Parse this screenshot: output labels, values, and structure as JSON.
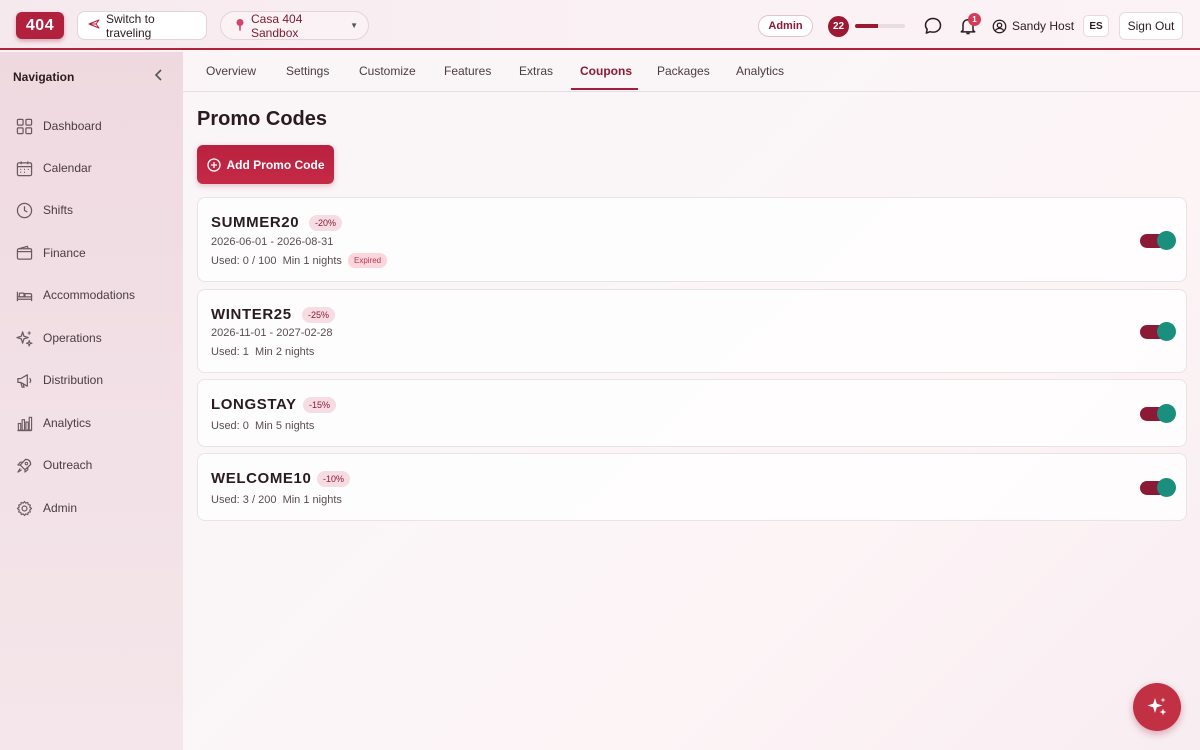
{
  "header": {
    "logo": "404",
    "switch_label": "Switch to traveling",
    "property_label": "Casa 404 Sandbox",
    "role_badge": "Admin",
    "level": "22",
    "level_progress": 0.45,
    "notification_count": "1",
    "user_name": "Sandy Host",
    "language": "ES",
    "signout_label": "Sign Out",
    "icons": [
      "plane-icon",
      "pin-icon",
      "chat-icon",
      "bell-icon",
      "user-icon"
    ]
  },
  "sidebar": {
    "title": "Navigation",
    "items": [
      {
        "label": "Dashboard",
        "icon": "dashboard-icon"
      },
      {
        "label": "Calendar",
        "icon": "calendar-icon"
      },
      {
        "label": "Shifts",
        "icon": "clock-icon"
      },
      {
        "label": "Finance",
        "icon": "wallet-icon"
      },
      {
        "label": "Accommodations",
        "icon": "bed-icon"
      },
      {
        "label": "Operations",
        "icon": "sparkles-icon"
      },
      {
        "label": "Distribution",
        "icon": "megaphone-icon"
      },
      {
        "label": "Analytics",
        "icon": "bar-chart-icon"
      },
      {
        "label": "Outreach",
        "icon": "rocket-icon"
      },
      {
        "label": "Admin",
        "icon": "gear-icon"
      }
    ]
  },
  "tabs": [
    {
      "label": "Overview"
    },
    {
      "label": "Settings"
    },
    {
      "label": "Customize"
    },
    {
      "label": "Features"
    },
    {
      "label": "Extras"
    },
    {
      "label": "Coupons",
      "active": true
    },
    {
      "label": "Packages"
    },
    {
      "label": "Analytics"
    }
  ],
  "main": {
    "title": "Promo Codes",
    "add_button": "Add Promo Code",
    "coupons": [
      {
        "code": "SUMMER20",
        "discount": "-20%",
        "dates": "2026-06-01 - 2026-08-31",
        "used": "Used: 0 / 100",
        "min": "Min 1 nights",
        "status": "Expired",
        "enabled": true
      },
      {
        "code": "WINTER25",
        "discount": "-25%",
        "dates": "2026-11-01 - 2027-02-28",
        "used": "Used: 1",
        "min": "Min 2 nights",
        "enabled": true
      },
      {
        "code": "LONGSTAY",
        "discount": "-15%",
        "used": "Used: 0",
        "min": "Min 5 nights",
        "enabled": true
      },
      {
        "code": "WELCOME10",
        "discount": "-10%",
        "used": "Used: 3 / 200",
        "min": "Min 1 nights",
        "enabled": true
      }
    ]
  },
  "colors": {
    "brand": "#b1203c",
    "toggle_on": "#1a8f7e",
    "toggle_track": "#8c1a36"
  }
}
